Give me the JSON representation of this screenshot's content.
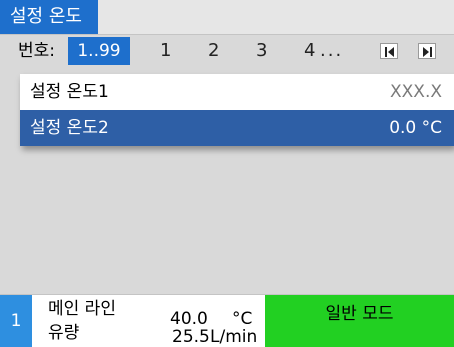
{
  "window": {
    "title": "설정 온도"
  },
  "tabs": {
    "label": "번호:",
    "range": "1..99",
    "numbers": [
      "1",
      "2",
      "3",
      "4"
    ],
    "ellipsis": "...",
    "prev_icon": "skip-back-icon",
    "next_icon": "skip-forward-icon"
  },
  "list": {
    "rows": [
      {
        "name": "설정 온도1",
        "value": "XXX.X",
        "selected": false
      },
      {
        "name": "설정 온도2",
        "value": "0.0 °C",
        "selected": true
      }
    ]
  },
  "status": {
    "index": "1",
    "line1_label": "메인 라인",
    "line2_label": "유량",
    "temp_value": "40.0",
    "temp_unit": "°C",
    "flow_value": "25.5",
    "flow_unit": "L/min",
    "mode": "일반 모드"
  },
  "colors": {
    "accent_blue": "#1e6fcc",
    "selection_blue": "#2e5fa6",
    "mode_green": "#22d022"
  }
}
